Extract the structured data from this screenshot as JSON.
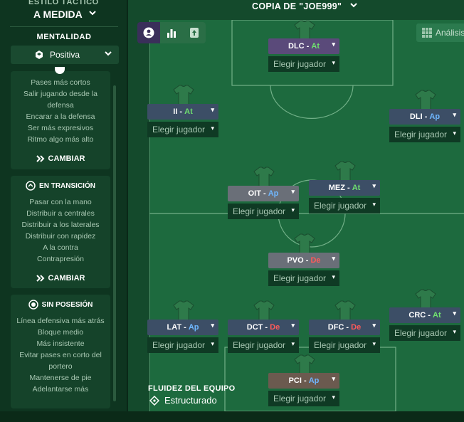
{
  "tactic": {
    "style_label": "ESTILO TÁCTICO",
    "style_value": "A MEDIDA",
    "copy_title": "COPIA DE \"JOE999\"",
    "analysis_label": "Análisis"
  },
  "mentality": {
    "title": "MENTALIDAD",
    "value": "Positiva"
  },
  "cards": {
    "in_possession": {
      "items": [
        "Pases más cortos",
        "Salir jugando desde la defensa",
        "Encarar a la defensa",
        "Ser más expresivos",
        "Ritmo algo más alto"
      ],
      "change_label": "CAMBIAR"
    },
    "in_transition": {
      "title": "EN TRANSICIÓN",
      "items": [
        "Pasar con la mano",
        "Distribuir a centrales",
        "Distribuir a los laterales",
        "Distribuir con rapidez",
        "A la contra",
        "Contrapresión"
      ],
      "change_label": "CAMBIAR"
    },
    "out_of_possession": {
      "title": "SIN POSESIÓN",
      "items": [
        "Línea defensiva más atrás",
        "Bloque medio",
        "Más insistente",
        "Evitar pases en corto del portero",
        "Mantenerse de pie",
        "Adelantarse más"
      ]
    }
  },
  "players": [
    {
      "id": "dlc",
      "code": "DLC",
      "duty": "At",
      "pick": "Elegir jugador"
    },
    {
      "id": "ii",
      "code": "II",
      "duty": "At",
      "pick": "Elegir jugador"
    },
    {
      "id": "dli",
      "code": "DLI",
      "duty": "Ap",
      "pick": "Elegir jugador"
    },
    {
      "id": "oit",
      "code": "OIT",
      "duty": "Ap",
      "pick": "Elegir jugador"
    },
    {
      "id": "mez",
      "code": "MEZ",
      "duty": "At",
      "pick": "Elegir jugador"
    },
    {
      "id": "pvo",
      "code": "PVO",
      "duty": "De",
      "pick": "Elegir jugador"
    },
    {
      "id": "lat",
      "code": "LAT",
      "duty": "Ap",
      "pick": "Elegir jugador"
    },
    {
      "id": "dct",
      "code": "DCT",
      "duty": "De",
      "pick": "Elegir jugador"
    },
    {
      "id": "dfc",
      "code": "DFC",
      "duty": "De",
      "pick": "Elegir jugador"
    },
    {
      "id": "crc",
      "code": "CRC",
      "duty": "At",
      "pick": "Elegir jugador"
    },
    {
      "id": "pci",
      "code": "PCI",
      "duty": "Ap",
      "pick": "Elegir jugador"
    }
  ],
  "fluidity": {
    "title": "FLUIDEZ DEL EQUIPO",
    "value": "Estructurado"
  },
  "colors": {
    "attack_role": "#5a4a7a",
    "support_role": "#3c4e66",
    "defend_role": "#6a6f78",
    "goalkeeper_role": "#6b5a4f",
    "attack_duty": "#6fe06f",
    "support_duty": "#6fb7ff",
    "defend_duty": "#ff5a5a"
  }
}
